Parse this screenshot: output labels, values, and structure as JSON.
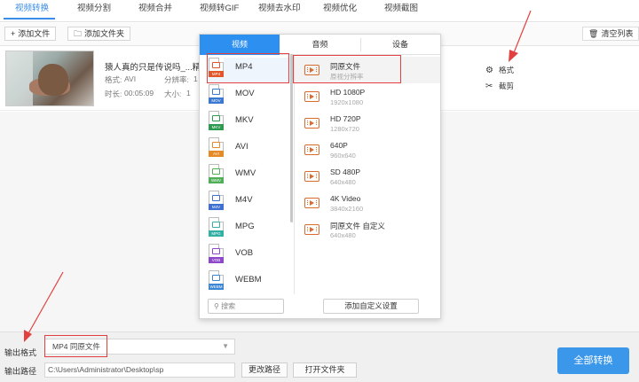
{
  "nav": {
    "tabs": [
      "视频转换",
      "视频分割",
      "视频合并",
      "视频转GIF",
      "视频去水印",
      "视频优化",
      "视频截图"
    ]
  },
  "toolbar": {
    "add_file": "添加文件",
    "add_folder": "添加文件夹",
    "clear_list": "清空列表"
  },
  "file": {
    "name": "猿人真的只是传说吗_...精.",
    "format_label": "格式:",
    "format_value": "AVI",
    "resolution_label": "分辨率:",
    "resolution_value": "1",
    "duration_label": "时长:",
    "duration_value": "00:05:09",
    "size_label": "大小:",
    "size_value": "1",
    "action_format": "格式",
    "action_cut": "截剪"
  },
  "popup": {
    "tabs": [
      "视频",
      "音频",
      "设备"
    ],
    "formats": [
      {
        "label": "MP4",
        "color": "#e2562b"
      },
      {
        "label": "MOV",
        "color": "#3a78d2"
      },
      {
        "label": "MKV",
        "color": "#2e9a4f"
      },
      {
        "label": "AVI",
        "color": "#e58a24"
      },
      {
        "label": "WMV",
        "color": "#4fb058"
      },
      {
        "label": "M4V",
        "color": "#3f6fd0"
      },
      {
        "label": "MPG",
        "color": "#33b0a4"
      },
      {
        "label": "VOB",
        "color": "#8d49c9"
      },
      {
        "label": "WEBM",
        "color": "#3d86d4"
      }
    ],
    "resolutions": [
      {
        "name": "同原文件",
        "sub": "原视分辨率"
      },
      {
        "name": "HD 1080P",
        "sub": "1920x1080"
      },
      {
        "name": "HD 720P",
        "sub": "1280x720"
      },
      {
        "name": "640P",
        "sub": "960x640"
      },
      {
        "name": "SD 480P",
        "sub": "640x480"
      },
      {
        "name": "4K Video",
        "sub": "3840x2160"
      },
      {
        "name": "同原文件 自定义",
        "sub": "640x480"
      }
    ],
    "search_placeholder": "搜索",
    "add_custom": "添加自定义设置"
  },
  "bottom": {
    "output_format_label": "输出格式",
    "output_format_value": "MP4   同原文件",
    "output_path_label": "输出路径",
    "output_path_value": "C:\\Users\\Administrator\\Desktop\\sp",
    "change_path": "更改路径",
    "open_folder": "打开文件夹",
    "convert_all": "全部转换"
  },
  "colors": {
    "accent": "#2d8ff0",
    "annotation": "#e24040"
  }
}
